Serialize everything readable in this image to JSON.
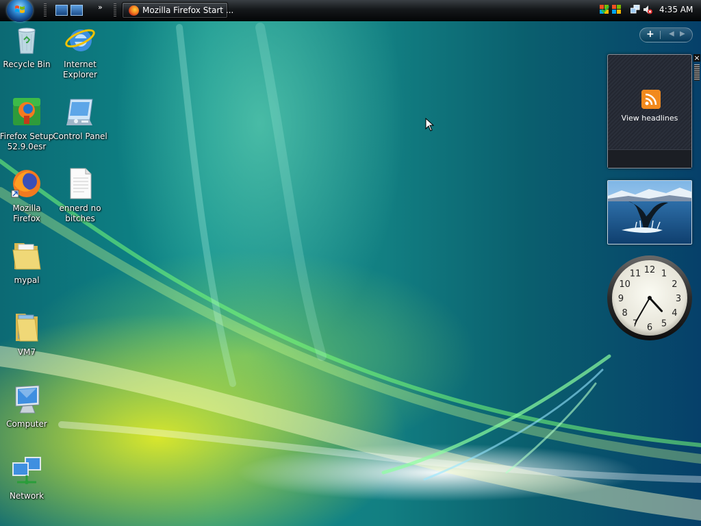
{
  "taskbar": {
    "start_button": "Start",
    "task_button_label": "Mozilla Firefox Start ...",
    "quicklaunch_more": "»",
    "time": "4:35 AM"
  },
  "desktop_icons": [
    {
      "label": "Recycle Bin",
      "icon": "recycle-bin-icon"
    },
    {
      "label": "Internet Explorer",
      "icon": "internet-explorer-icon"
    },
    {
      "label": "Firefox Setup 52.9.0esr",
      "icon": "firefox-setup-icon"
    },
    {
      "label": "Control Panel",
      "icon": "control-panel-icon"
    },
    {
      "label": "Mozilla Firefox",
      "icon": "firefox-icon"
    },
    {
      "label": "ennerd no bitches",
      "icon": "text-document-icon"
    },
    {
      "label": "mypal",
      "icon": "folder-icon"
    },
    {
      "label": "VM7",
      "icon": "folder-icon"
    },
    {
      "label": "Computer",
      "icon": "computer-icon"
    },
    {
      "label": "Network",
      "icon": "network-icon"
    }
  ],
  "sidebar": {
    "add_label": "+",
    "prev_label": "◀",
    "next_label": "▶",
    "close_label": "×",
    "feed_gadget_label": "View headlines",
    "clock": {
      "hour": 4,
      "minute": 35,
      "second": 35
    }
  },
  "colors": {
    "accent": "#2a7fc9",
    "rss": "#f07a10",
    "taskbar": "#15181b"
  }
}
